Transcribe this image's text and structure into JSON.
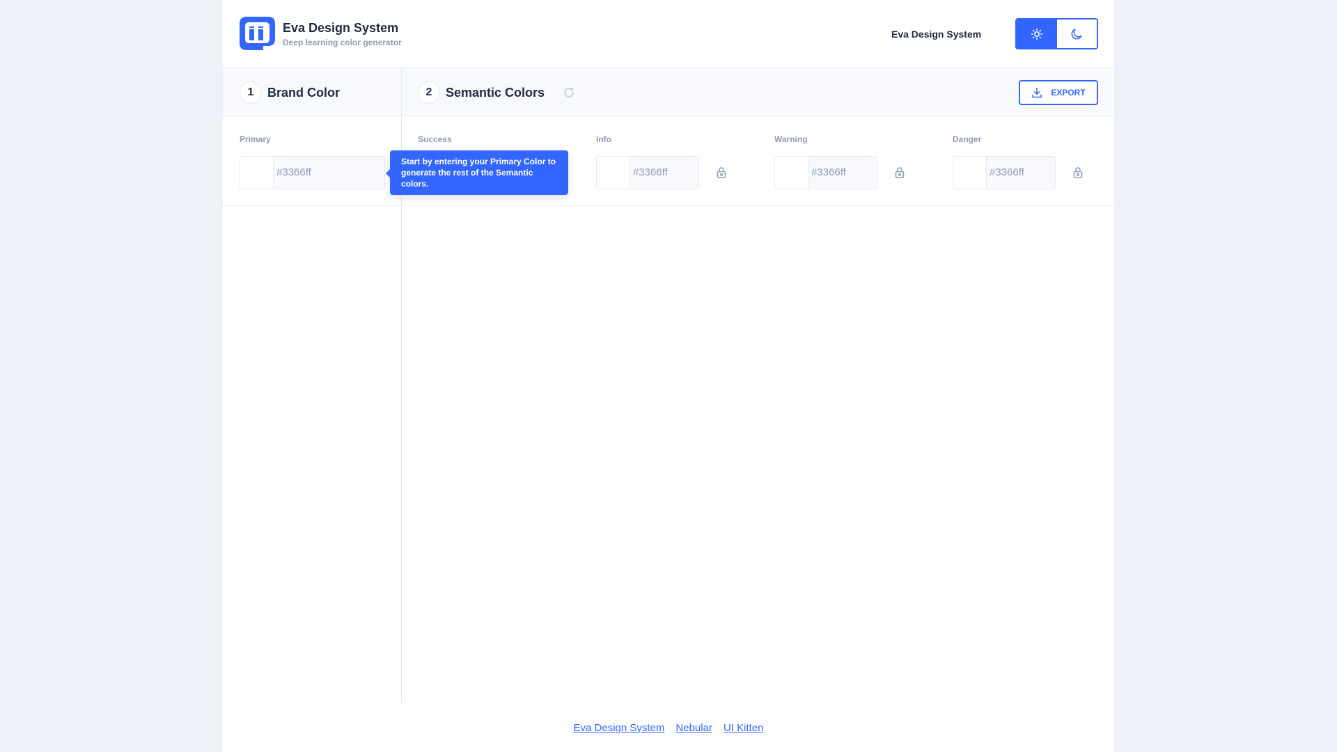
{
  "header": {
    "brand_title": "Eva Design System",
    "brand_subtitle": "Deep learning color generator",
    "link_label": "Eva Design System",
    "theme_light_icon": "sun-icon",
    "theme_dark_icon": "moon-icon"
  },
  "sections": {
    "brand": {
      "number": "1",
      "title": "Brand Color"
    },
    "semantic": {
      "number": "2",
      "title": "Semantic Colors"
    },
    "export_label": "EXPORT"
  },
  "fields": {
    "primary": {
      "label": "Primary",
      "value": "#3366ff"
    },
    "success": {
      "label": "Success"
    },
    "info": {
      "label": "Info",
      "value": "#3366ff"
    },
    "warning": {
      "label": "Warning",
      "value": "#3366ff"
    },
    "danger": {
      "label": "Danger",
      "value": "#3366ff"
    }
  },
  "tooltip": {
    "text": "Start by entering your Primary Color to generate the rest of the Semantic colors."
  },
  "footer": {
    "links": [
      "Eva Design System",
      "Nebular",
      "UI Kitten"
    ]
  },
  "colors": {
    "accent": "#3366ff",
    "text": "#222b45",
    "muted": "#8f9bb3",
    "border": "#e4e9f2",
    "page_bg": "#edf1f7"
  }
}
